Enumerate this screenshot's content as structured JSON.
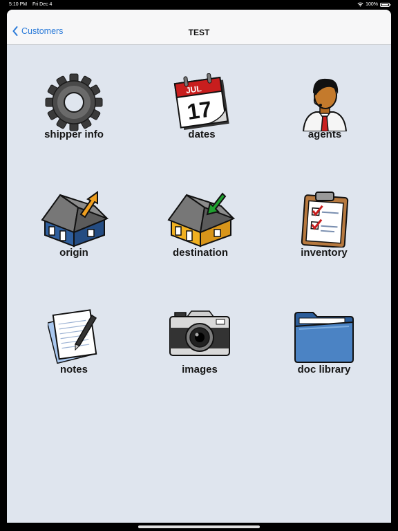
{
  "status_bar": {
    "time": "5:10 PM",
    "date": "Fri Dec 4",
    "wifi_icon": "wifi-icon",
    "battery_percent": "100%",
    "battery_level": 1.0
  },
  "navbar": {
    "back_label": "Customers",
    "back_icon": "chevron-left-icon",
    "title": "TEST"
  },
  "tiles": [
    {
      "label": "shipper info",
      "icon": "gear-icon"
    },
    {
      "label": "dates",
      "icon": "calendar-icon",
      "calendar_month": "JUL",
      "calendar_day": "17"
    },
    {
      "label": "agents",
      "icon": "agent-icon"
    },
    {
      "label": "origin",
      "icon": "origin-house-icon"
    },
    {
      "label": "destination",
      "icon": "destination-house-icon"
    },
    {
      "label": "inventory",
      "icon": "clipboard-icon"
    },
    {
      "label": "notes",
      "icon": "notes-icon"
    },
    {
      "label": "images",
      "icon": "camera-icon"
    },
    {
      "label": "doc library",
      "icon": "folder-icon"
    }
  ],
  "colors": {
    "accent": "#2b7bd9",
    "background": "#dfe5ee",
    "navbar": "#f7f7f8"
  }
}
